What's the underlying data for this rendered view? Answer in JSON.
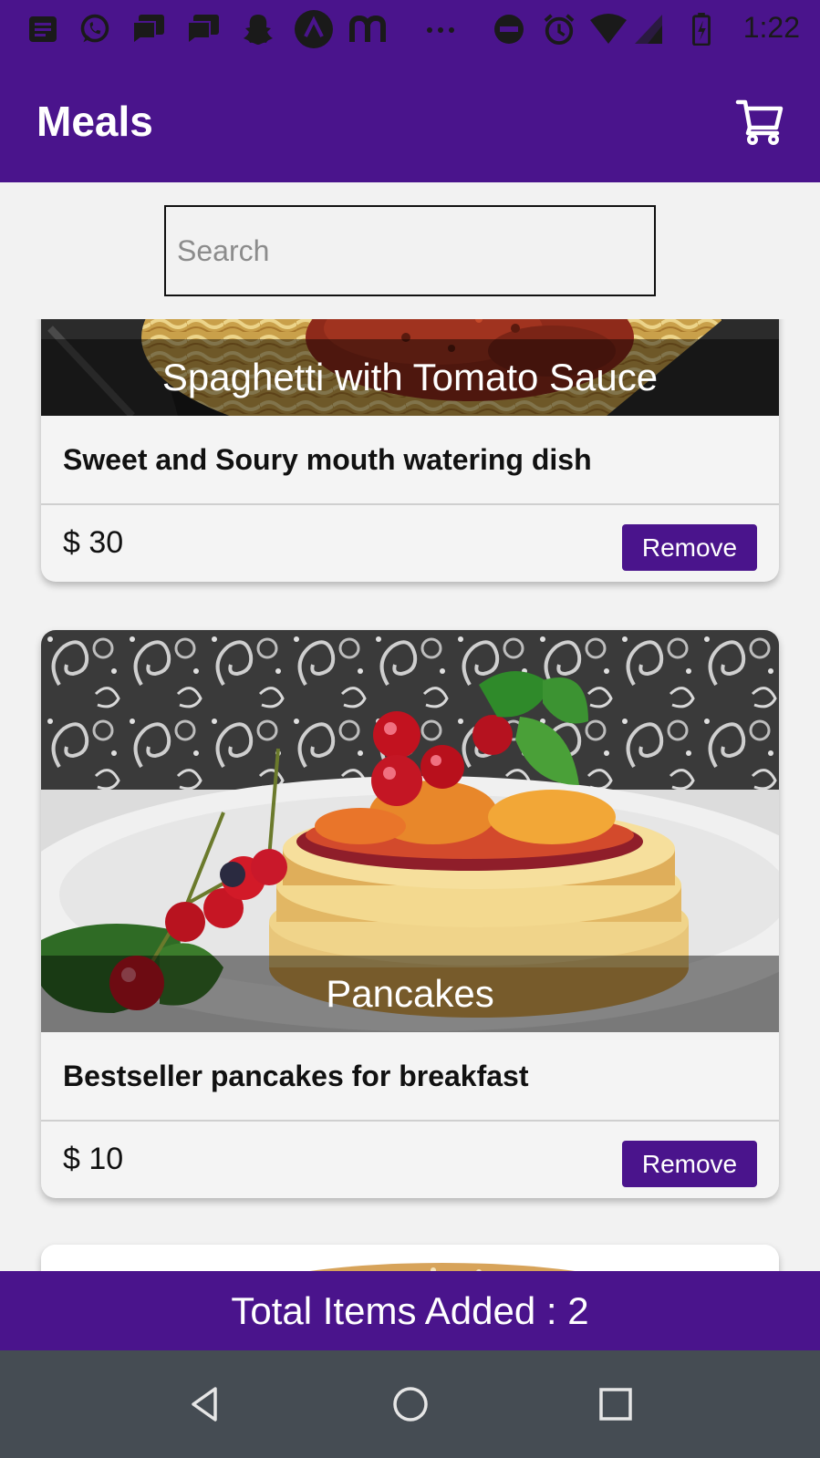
{
  "status_bar": {
    "time": "1:22",
    "icons": [
      "message-icon",
      "whatsapp-icon",
      "chat-icon",
      "chat-icon",
      "snapchat-icon",
      "app-icon",
      "m-icon",
      "more-icon",
      "dnd-icon",
      "alarm-icon",
      "wifi-icon",
      "signal-icon",
      "battery-icon"
    ]
  },
  "app_bar": {
    "title": "Meals",
    "cart_icon": "cart-icon"
  },
  "search": {
    "placeholder": "Search",
    "value": ""
  },
  "meals": [
    {
      "name": "Spaghetti with Tomato Sauce",
      "description": "Sweet and Soury mouth watering dish",
      "price": "$ 30",
      "action_label": "Remove"
    },
    {
      "name": "Pancakes",
      "description": "Bestseller pancakes for breakfast",
      "price": "$ 10",
      "action_label": "Remove"
    }
  ],
  "footer": {
    "total_label": "Total Items Added : 2"
  },
  "nav_bar": {
    "back_icon": "back-icon",
    "home_icon": "home-icon",
    "recents_icon": "recents-icon"
  },
  "colors": {
    "primary": "#4a148c",
    "background": "#f2f2f2",
    "nav_bar": "#454c53"
  }
}
